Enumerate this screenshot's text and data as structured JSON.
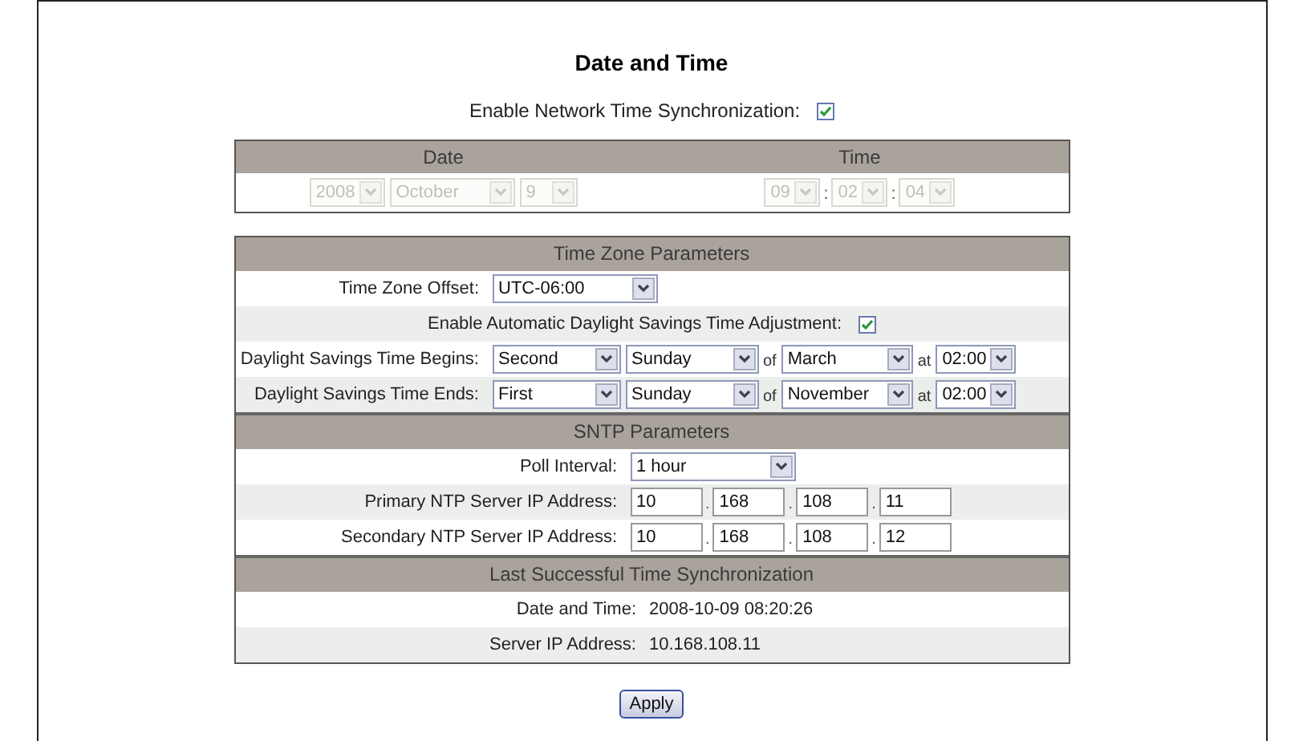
{
  "title": "Date and Time",
  "network_sync": {
    "label": "Enable Network Time Synchronization:",
    "checked": true
  },
  "manual": {
    "date_header": "Date",
    "time_header": "Time",
    "date_selects": [
      {
        "value": "2008",
        "disabled": true
      },
      {
        "value": "October",
        "disabled": true
      },
      {
        "value": "9",
        "disabled": true
      }
    ],
    "time_selects": [
      {
        "value": "09",
        "disabled": true
      },
      {
        "value": "02",
        "disabled": true
      },
      {
        "value": "04",
        "disabled": true
      }
    ],
    "time_separators": [
      ":",
      ":"
    ]
  },
  "sections": [
    {
      "header": "Time Zone Parameters",
      "rows": [
        {
          "kind": "select",
          "label": "Time Zone Offset:",
          "value": "UTC-06:00"
        },
        {
          "kind": "checkbox",
          "label": "Enable Automatic Daylight Savings Time Adjustment:",
          "checked": true
        },
        {
          "kind": "dst",
          "label": "Daylight Savings Time Begins:",
          "week": "Second",
          "day": "Sunday",
          "of": "of",
          "month": "March",
          "at": "at",
          "time": "02:00"
        },
        {
          "kind": "dst",
          "label": "Daylight Savings Time Ends:",
          "week": "First",
          "day": "Sunday",
          "of": "of",
          "month": "November",
          "at": "at",
          "time": "02:00"
        }
      ]
    },
    {
      "header": "SNTP Parameters",
      "rows": [
        {
          "kind": "select",
          "label": "Poll Interval:",
          "value": "1 hour"
        },
        {
          "kind": "ip",
          "label": "Primary NTP Server IP Address:",
          "octets": [
            "10",
            "168",
            "108",
            "11"
          ],
          "separators": [
            ".",
            ".",
            "."
          ]
        },
        {
          "kind": "ip",
          "label": "Secondary NTP Server IP Address:",
          "octets": [
            "10",
            "168",
            "108",
            "12"
          ],
          "separators": [
            ".",
            ".",
            "."
          ]
        }
      ]
    },
    {
      "header": "Last Successful Time Synchronization",
      "rows": [
        {
          "kind": "info",
          "label": "Date and Time:",
          "value": "2008-10-09 08:20:26"
        },
        {
          "kind": "info",
          "label": "Server IP Address:",
          "value": "10.168.108.11"
        }
      ]
    }
  ],
  "apply_button": "Apply"
}
